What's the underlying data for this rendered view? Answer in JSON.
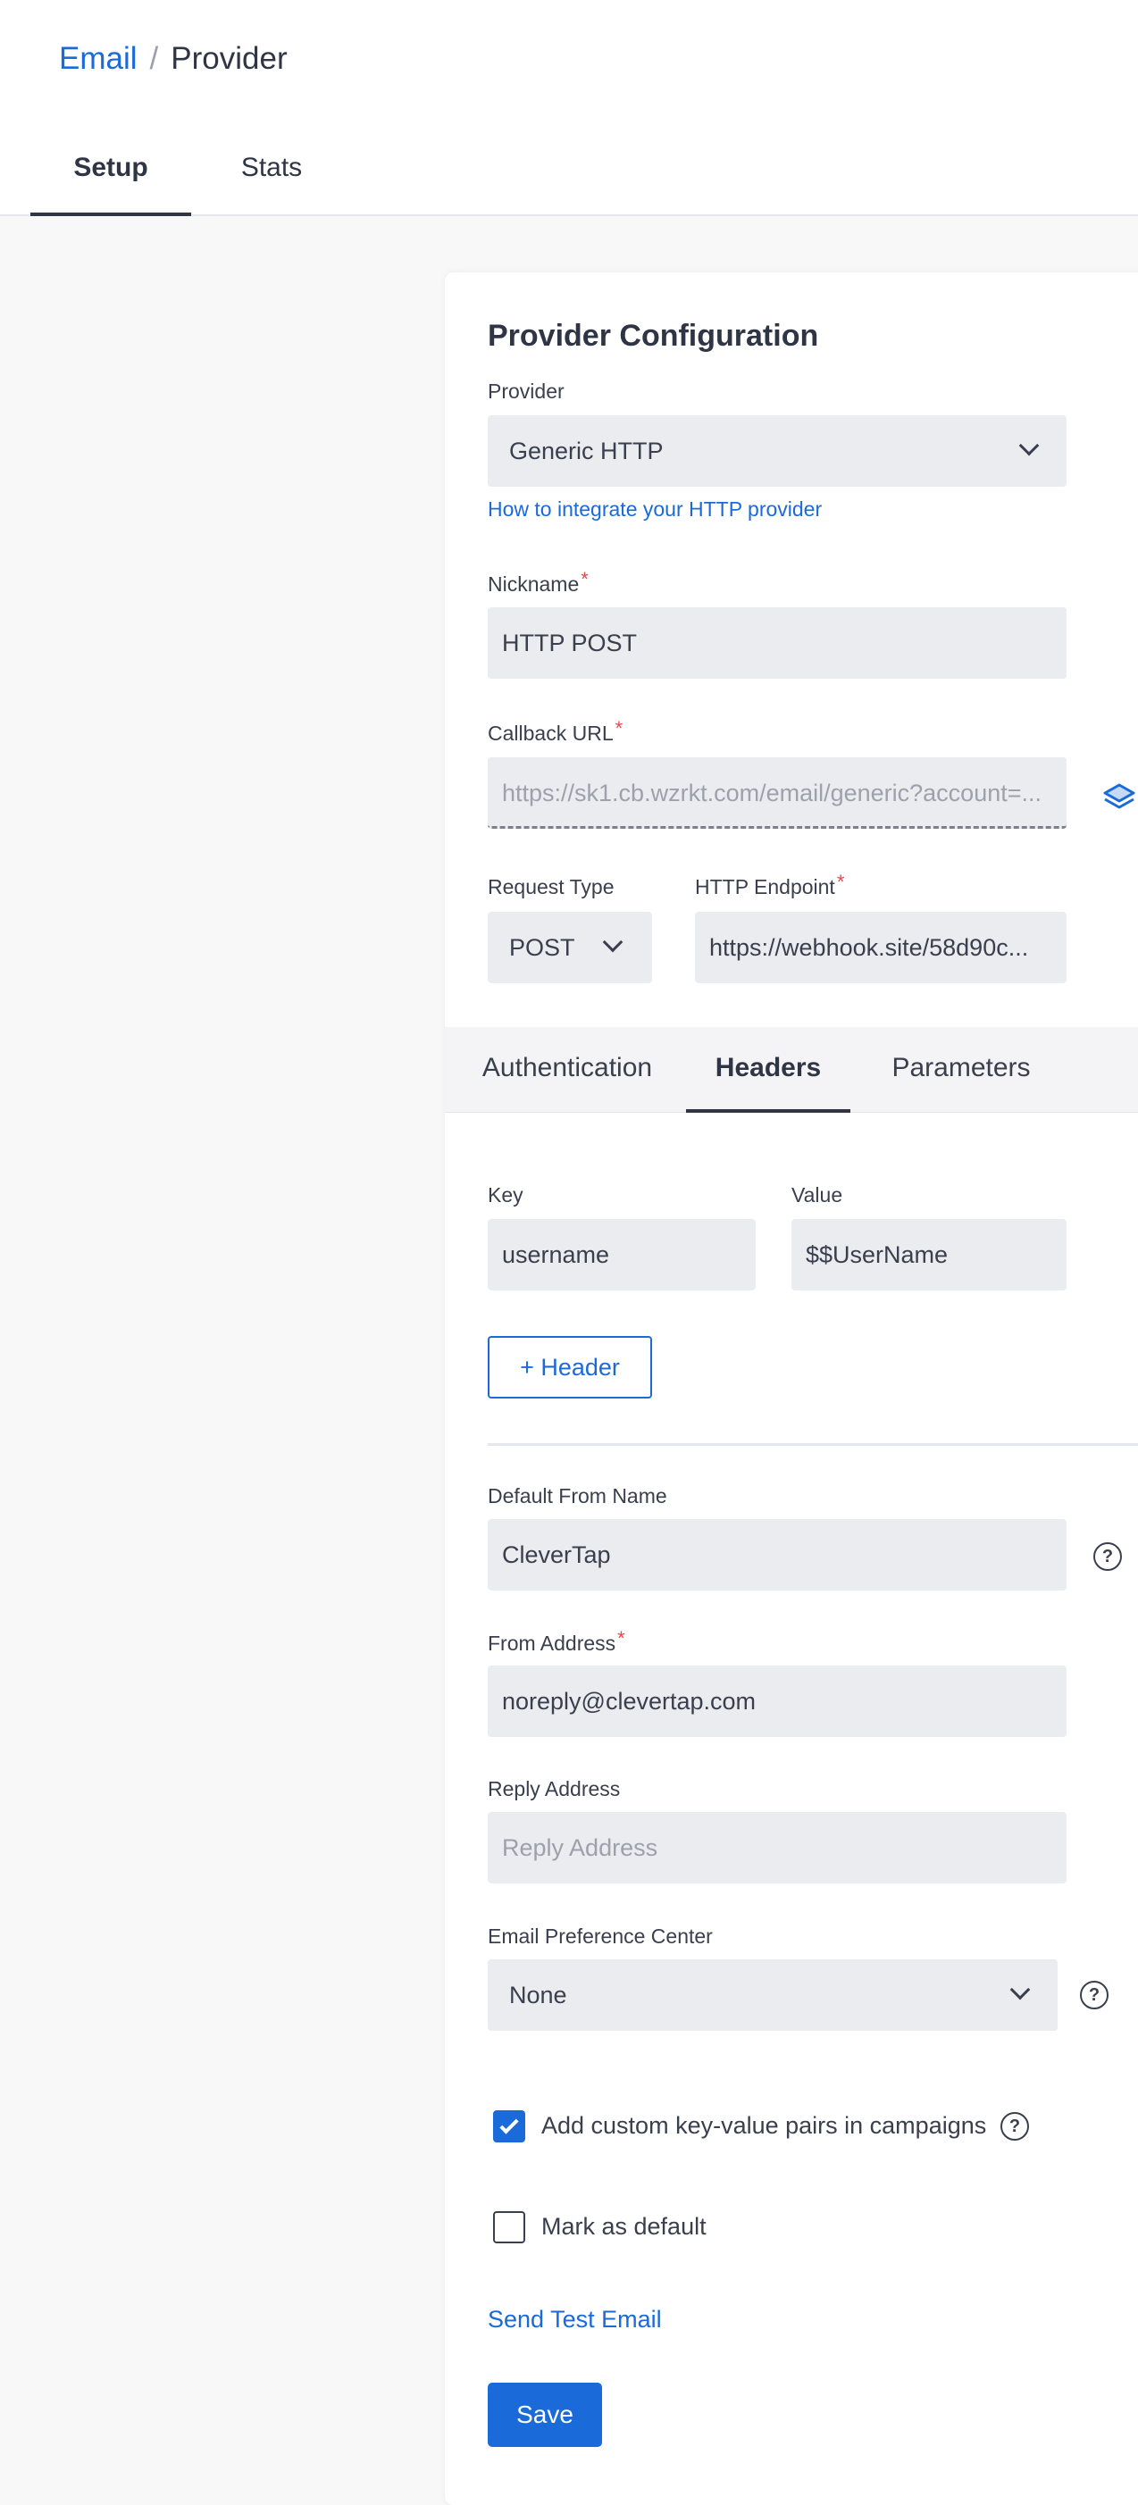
{
  "breadcrumb": {
    "parent": "Email",
    "separator": "/",
    "current": "Provider"
  },
  "page_tabs": [
    {
      "label": "Setup",
      "active": true
    },
    {
      "label": "Stats",
      "active": false
    }
  ],
  "config": {
    "title": "Provider Configuration",
    "provider": {
      "label": "Provider",
      "value": "Generic HTTP"
    },
    "integrate_link": "How to integrate your HTTP provider",
    "nickname": {
      "label": "Nickname",
      "required": "*",
      "value": "HTTP POST"
    },
    "callback_url": {
      "label": "Callback URL",
      "required": "*",
      "value": "https://sk1.cb.wzrkt.com/email/generic?account=..."
    },
    "request_type": {
      "label": "Request Type",
      "value": "POST"
    },
    "http_endpoint": {
      "label": "HTTP Endpoint",
      "required": "*",
      "value": "https://webhook.site/58d90c..."
    }
  },
  "sub_tabs": [
    {
      "label": "Authentication",
      "active": false
    },
    {
      "label": "Headers",
      "active": true
    },
    {
      "label": "Parameters",
      "active": false
    }
  ],
  "headers": {
    "key_label": "Key",
    "value_label": "Value",
    "key": "username",
    "value": "$$UserName",
    "add_button": "+ Header"
  },
  "from_name": {
    "label": "Default From Name",
    "value": "CleverTap"
  },
  "from_address": {
    "label": "From Address",
    "required": "*",
    "value": "noreply@clevertap.com"
  },
  "reply_address": {
    "label": "Reply Address",
    "placeholder": "Reply Address"
  },
  "preference_center": {
    "label": "Email Preference Center",
    "value": "None"
  },
  "help_glyph": "?",
  "custom_kv": {
    "label": "Add custom key-value pairs in campaigns",
    "checked": true
  },
  "mark_default": {
    "label": "Mark as default",
    "checked": false
  },
  "send_test": "Send Test Email",
  "save": "Save",
  "colors": {
    "accent": "#1a6ad9",
    "required": "#e5484d",
    "field_bg": "#ebecf0"
  }
}
